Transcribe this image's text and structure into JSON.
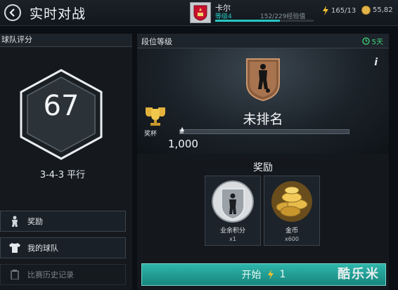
{
  "header": {
    "title": "实时对战",
    "player_name": "卡尔",
    "level_label": "等级4",
    "xp_text": "152/229经验值",
    "xp_progress": 0.66,
    "energy": "165/13",
    "coins": "55,82"
  },
  "team_rating": {
    "panel_title": "球队评分",
    "rating": "67",
    "formation": "3-4-3 平行"
  },
  "left_menu": {
    "items": [
      {
        "label": "奖励"
      },
      {
        "label": "我的球队"
      },
      {
        "label": "比赛历史记录"
      }
    ]
  },
  "division": {
    "panel_title": "段位等级",
    "timer": "5天",
    "rank_name": "未排名",
    "trophy_label": "奖杯",
    "progress_value": "1,000",
    "progress_fraction": 0.02
  },
  "rewards": {
    "title": "奖励",
    "items": [
      {
        "name": "业余积分",
        "qty": "x1",
        "icon": "amateur-badge"
      },
      {
        "name": "金币",
        "qty": "x600",
        "icon": "gold-coins"
      }
    ]
  },
  "start": {
    "label": "开始",
    "cost": "1"
  },
  "watermark": "酷乐米",
  "colors": {
    "accent": "#27c7c1",
    "start_button": "#1f9a90",
    "timer": "#3fd67a",
    "gold": "#e3b449"
  }
}
